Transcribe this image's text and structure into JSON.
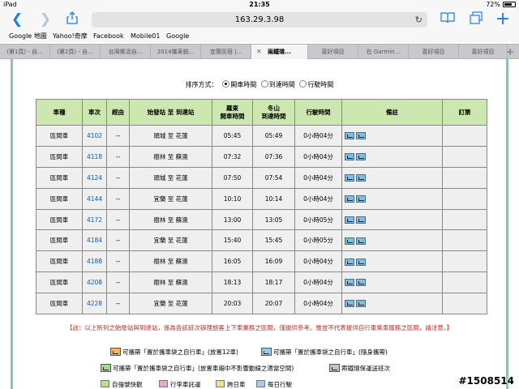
{
  "status": {
    "device": "iPad",
    "time": "21:35",
    "battery": "72%",
    "battery_level": 0.72
  },
  "toolbar": {
    "url": "163.29.3.98"
  },
  "bookmarks": [
    "Google 地圖",
    "Yahoo!奇摩",
    "Facebook",
    "Mobile01",
    "Google"
  ],
  "tabs": [
    {
      "label": "(第1頁) - 自..."
    },
    {
      "label": "(第2頁) - 自..."
    },
    {
      "label": "台灣樂活自..."
    },
    {
      "label": "2014攜車鉑..."
    },
    {
      "label": "宜蘭民宿 |..."
    },
    {
      "label": "兩鐵環...",
      "active": true
    },
    {
      "label": "喜好項目"
    },
    {
      "label": "在 Garmin..."
    },
    {
      "label": "喜好項目"
    },
    {
      "label": "喜好項目"
    }
  ],
  "sort": {
    "label": "排序方式：",
    "options": [
      "開車時間",
      "到達時間",
      "行駛時間"
    ],
    "selected": 0
  },
  "table": {
    "headers": [
      "車種",
      "車次",
      "經由",
      "始發站 至 到達站",
      "羅東\n開車時間",
      "冬山\n到達時間",
      "行駛時間",
      "備註",
      "訂票"
    ],
    "rows": [
      [
        "區間車",
        "4102",
        "--",
        "頭城 至 花蓮",
        "05:45",
        "05:49",
        "0小時04分"
      ],
      [
        "區間車",
        "4118",
        "--",
        "樹林 至 蘇澳",
        "07:32",
        "07:36",
        "0小時04分"
      ],
      [
        "區間車",
        "4124",
        "--",
        "頭城 至 花蓮",
        "07:50",
        "07:54",
        "0小時04分"
      ],
      [
        "區間車",
        "4144",
        "--",
        "宜蘭 至 花蓮",
        "10:10",
        "10:14",
        "0小時04分"
      ],
      [
        "區間車",
        "4172",
        "--",
        "樹林 至 蘇澳",
        "13:00",
        "13:05",
        "0小時05分"
      ],
      [
        "區間車",
        "4184",
        "--",
        "宜蘭 至 花蓮",
        "15:40",
        "15:45",
        "0小時05分"
      ],
      [
        "區間車",
        "4188",
        "--",
        "樹林 至 蘇澳",
        "16:05",
        "16:09",
        "0小時04分"
      ],
      [
        "區間車",
        "4208",
        "--",
        "樹林 至 蘇澳",
        "18:13",
        "18:17",
        "0小時04分"
      ],
      [
        "區間車",
        "4228",
        "--",
        "宜蘭 至 花蓮",
        "20:03",
        "20:07",
        "0小時04分"
      ]
    ]
  },
  "note": "【註：以上所列之始發站與到達站，係為各該班次辦理旅客上下車業務之區間，僅提供參考。惟並不代表提供自行車乘車服務之區間，請注意。】",
  "legend": {
    "row1": [
      "可攜帶「置於攜車袋之自行車」(放置12車)",
      "可攜帶「置於攜車袋之自行車」(隨身攜帶)"
    ],
    "row2": [
      "可攜帶「置於攜車袋之自行車」(放置車廂中不影響動線之適當空間)",
      "兩鐵環保運送班次"
    ],
    "row3": [
      "自強號快觀",
      "行李車託運",
      "跨日車",
      "每日行駛"
    ]
  },
  "watermark": "#1508514",
  "colors": {
    "header_bg": "#cde7b0",
    "row_bg": "#efefef",
    "link": "#1a56a8",
    "note": "#d0261c",
    "ios_blue": "#1a7cf5"
  }
}
